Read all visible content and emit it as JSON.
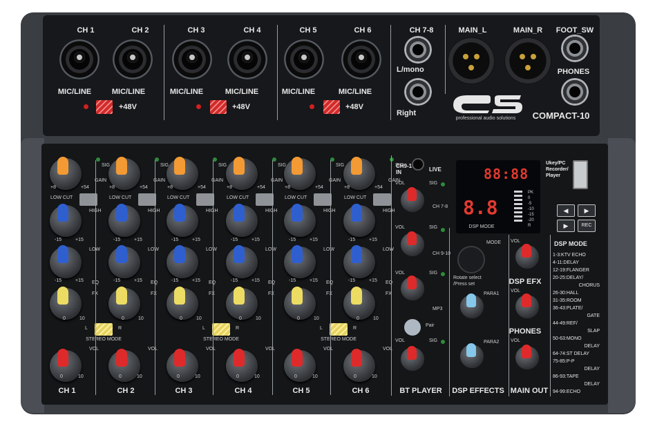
{
  "top_panel": {
    "channels": [
      "CH 1",
      "CH 2",
      "CH 3",
      "CH 4",
      "CH 5",
      "CH 6"
    ],
    "input_label": "MIC/LINE",
    "phantom": "+48V",
    "ch78": "CH 7-8",
    "lmono": "L/mono",
    "right": "Right",
    "main_l": "MAIN_L",
    "main_r": "MAIN_R",
    "foot_sw": "FOOT_SW",
    "phones": "PHONES",
    "brand": "es",
    "tagline": "professional audio solutions",
    "model": "COMPACT-10"
  },
  "channel_strip": {
    "sig": "SIG",
    "gain": "GAIN",
    "gain_min": "+8",
    "gain_max": "+54",
    "low_cut": "LOW CUT",
    "high": "HIGH",
    "low": "LOW",
    "eq": "EQ",
    "eq_min": "-15",
    "eq_max": "+15",
    "fx": "FX",
    "vol": "VOL",
    "zero": "0",
    "ten": "10",
    "l": "L",
    "r": "R",
    "stereo_mode": "STEREO MODE",
    "names": [
      "CH 1",
      "CH 2",
      "CH 3",
      "CH 4",
      "CH 5",
      "CH 6"
    ]
  },
  "mid_section": {
    "ch910_in": "CH9-10\nIN",
    "live": "LIVE",
    "vol": "VOL",
    "sig": "SIG",
    "ch78": "CH 7-8",
    "ch910": "CH 9-10",
    "mp3": "MP3",
    "pair": "Pair",
    "bt_player": "BT PLAYER"
  },
  "dsp_section": {
    "lcd_digits": "88:88",
    "seg_digits": "8.8",
    "dsp_mode_lcd": "DSP MODE",
    "meter": [
      "PK",
      "0",
      "-5",
      "-10",
      "-15",
      "-20",
      "R"
    ],
    "mode": "MODE",
    "rotate": "Rotate select /Press set",
    "para1": "PARA1",
    "para2": "PARA2",
    "dsp_effects": "DSP EFFECTS"
  },
  "right_section": {
    "usb": "Ukey/PC Recorder/ Player",
    "rec": "REC",
    "vol": "VOL",
    "dsp_efx": "DSP EFX",
    "phones": "PHONES",
    "main_out": "MAIN OUT",
    "dsp_mode_title": "DSP MODE",
    "dsp_modes": [
      "1-3:KTV ECHO",
      "4-11:DELAY",
      "12-19:FLANGER",
      "20-25:DELAY/",
      "CHORUS",
      "26-30:HALL",
      "31-35:ROOM",
      "36-43:PLATE/",
      "GATE",
      "44-49:REF/",
      "SLAP",
      "50-63:MONO",
      "DELAY",
      "64-74:ST DELAY",
      "75-85:P-P",
      "DELAY",
      "86-93:TAPE",
      "DELAY",
      "94-99:ECHO"
    ]
  }
}
